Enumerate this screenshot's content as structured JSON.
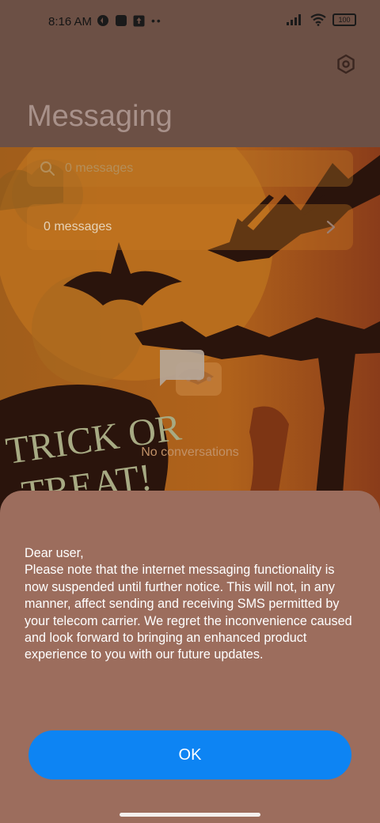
{
  "status_bar": {
    "time": "8:16 AM",
    "battery": "100"
  },
  "header": {
    "title": "Messaging",
    "settings_icon": "gear-icon"
  },
  "search": {
    "placeholder": "0 messages"
  },
  "messages_row": {
    "label": "0 messages"
  },
  "empty_state": {
    "text": "No conversations"
  },
  "dialog": {
    "greeting": "Dear user,",
    "body": "Please note that the internet messaging functionality is now suspended until further notice. This will not, in any manner, affect sending and receiving SMS permitted by your telecom carrier. We regret the inconvenience caused and look forward to bringing an enhanced product experience to you with our future updates.",
    "ok_label": "OK"
  },
  "wallpaper": {
    "text_line1": "TRICK OR",
    "text_line2": "TREAT!"
  },
  "colors": {
    "accent": "#0d84f3",
    "sheet": "#9c6d5d"
  }
}
